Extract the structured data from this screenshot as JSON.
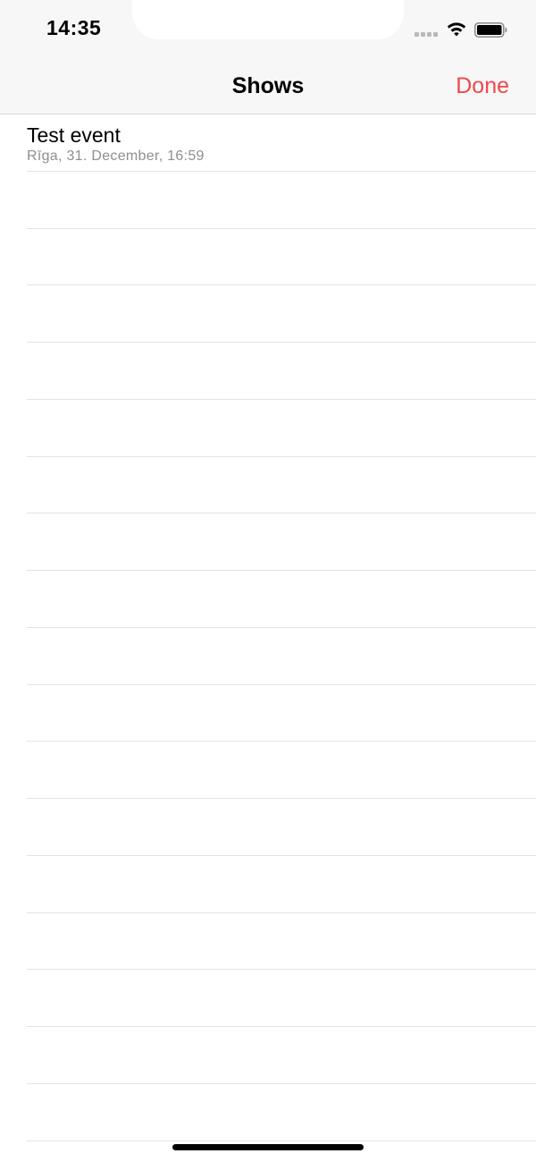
{
  "status_bar": {
    "time": "14:35",
    "icons": [
      "signal-dots-icon",
      "wifi-icon",
      "battery-icon"
    ]
  },
  "nav": {
    "title": "Shows",
    "done_label": "Done",
    "accent_color": "#f0484a"
  },
  "events": [
    {
      "title": "Test event",
      "subtitle": "Rīga, 31. December, 16:59"
    }
  ]
}
